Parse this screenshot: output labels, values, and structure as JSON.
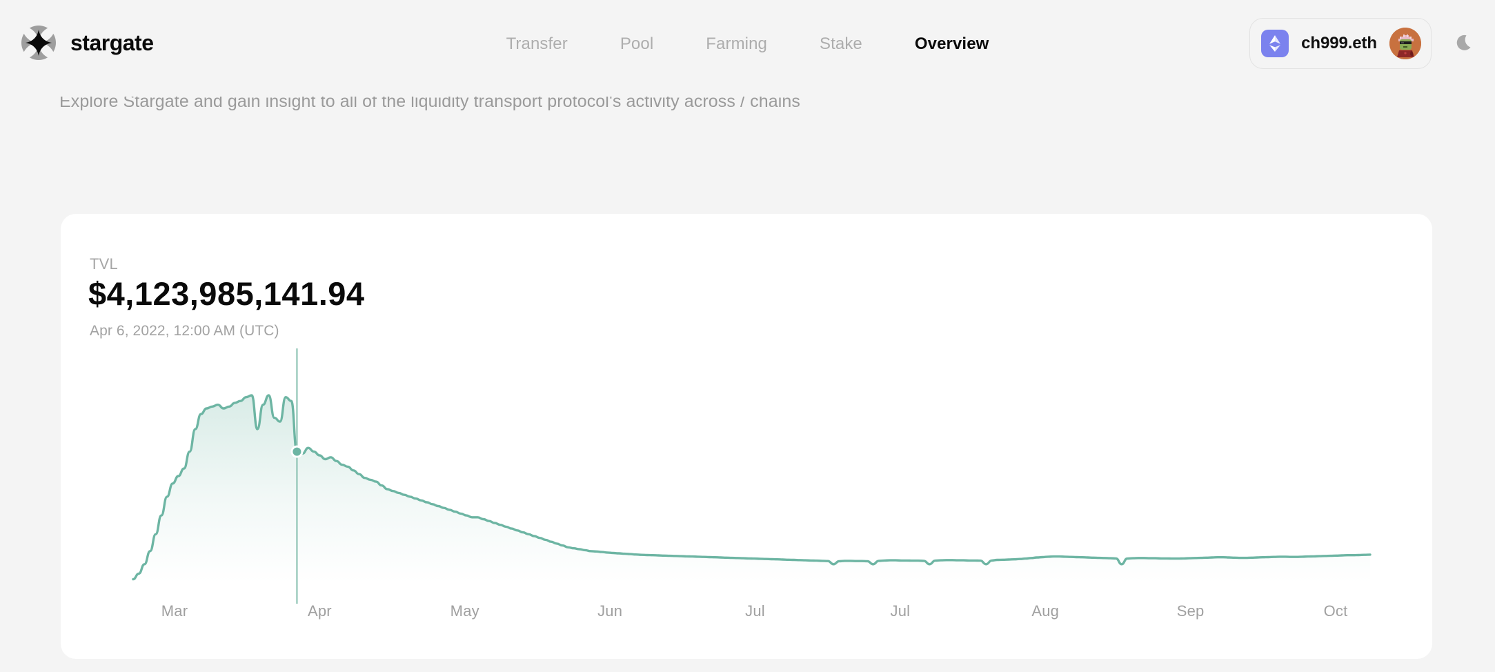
{
  "brand": {
    "name": "stargate",
    "logo_icon": "stargate-star-logo"
  },
  "nav": {
    "items": [
      {
        "label": "Transfer",
        "active": false
      },
      {
        "label": "Pool",
        "active": false
      },
      {
        "label": "Farming",
        "active": false
      },
      {
        "label": "Stake",
        "active": false
      },
      {
        "label": "Overview",
        "active": true
      }
    ]
  },
  "wallet": {
    "chain_icon": "ethereum-diamond-icon",
    "address": "ch999.eth",
    "avatar_icon": "user-avatar"
  },
  "theme_toggle": {
    "icon": "moon-icon"
  },
  "subtitle": "Explore Stargate and gain insight to all of the liquidity transport protocol's activity across / chains",
  "card": {
    "label": "TVL",
    "value": "$4,123,985,141.94",
    "timestamp": "Apr 6, 2022, 12:00 AM (UTC)"
  },
  "colors": {
    "line": "#6db5a3",
    "area_top": "#d8ebe5",
    "page_bg": "#f4f4f4",
    "card_bg": "#ffffff",
    "accent_chain": "#7b82ee",
    "avatar_bg": "#c8713f",
    "text_primary": "#0a0a0a",
    "text_muted": "#a0a0a0"
  },
  "chart_data": {
    "type": "area",
    "title": "TVL",
    "xlabel": "",
    "ylabel": "",
    "grid": false,
    "legend": false,
    "x_tick_labels": [
      "Mar",
      "Apr",
      "May",
      "Jun",
      "Jul",
      "Jul",
      "Aug",
      "Sep",
      "Oct"
    ],
    "x_tick_positions_pct": [
      5.0,
      12.6,
      20.2,
      27.8,
      35.4,
      43.0,
      50.6,
      58.2,
      65.8
    ],
    "highlight": {
      "label": "Apr 6, 2022, 12:00 AM (UTC)",
      "value": 4123985141.94,
      "value_formatted": "$4,123,985,141.94",
      "x_pct": 9.1
    },
    "series": [
      {
        "name": "TVL",
        "units": "USD",
        "values": [
          0.02,
          0.05,
          0.1,
          0.17,
          0.26,
          0.36,
          0.46,
          0.53,
          0.57,
          0.61,
          0.7,
          0.82,
          0.9,
          0.93,
          0.94,
          0.95,
          0.93,
          0.94,
          0.96,
          0.97,
          0.99,
          1.0,
          0.82,
          0.95,
          1.0,
          0.88,
          0.86,
          0.99,
          0.97,
          0.7,
          0.69,
          0.72,
          0.7,
          0.68,
          0.66,
          0.67,
          0.65,
          0.63,
          0.62,
          0.6,
          0.58,
          0.56,
          0.55,
          0.54,
          0.52,
          0.5,
          0.49,
          0.48,
          0.47,
          0.46,
          0.45,
          0.44,
          0.43,
          0.42,
          0.41,
          0.4,
          0.39,
          0.38,
          0.37,
          0.36,
          0.35,
          0.35,
          0.34,
          0.33,
          0.32,
          0.31,
          0.3,
          0.29,
          0.28,
          0.27,
          0.26,
          0.25,
          0.24,
          0.23,
          0.22,
          0.21,
          0.2,
          0.19,
          0.185,
          0.18,
          0.175,
          0.17,
          0.168,
          0.165,
          0.162,
          0.16,
          0.158,
          0.156,
          0.154,
          0.152,
          0.15,
          0.149,
          0.148,
          0.147,
          0.146,
          0.145,
          0.144,
          0.143,
          0.142,
          0.141,
          0.14,
          0.139,
          0.138,
          0.137,
          0.136,
          0.135,
          0.134,
          0.133,
          0.132,
          0.131,
          0.13,
          0.129,
          0.128,
          0.127,
          0.126,
          0.125,
          0.124,
          0.123,
          0.122,
          0.121,
          0.12,
          0.119,
          0.118,
          0.117,
          0.1,
          0.116,
          0.118,
          0.118,
          0.117,
          0.117,
          0.116,
          0.1,
          0.118,
          0.12,
          0.121,
          0.121,
          0.12,
          0.12,
          0.119,
          0.119,
          0.118,
          0.1,
          0.119,
          0.121,
          0.122,
          0.122,
          0.121,
          0.121,
          0.12,
          0.12,
          0.119,
          0.1,
          0.12,
          0.123,
          0.124,
          0.125,
          0.126,
          0.128,
          0.13,
          0.133,
          0.136,
          0.138,
          0.14,
          0.141,
          0.141,
          0.14,
          0.139,
          0.138,
          0.137,
          0.136,
          0.135,
          0.134,
          0.133,
          0.132,
          0.131,
          0.1,
          0.13,
          0.132,
          0.133,
          0.133,
          0.132,
          0.132,
          0.131,
          0.131,
          0.13,
          0.13,
          0.131,
          0.132,
          0.133,
          0.134,
          0.135,
          0.136,
          0.137,
          0.137,
          0.136,
          0.135,
          0.134,
          0.134,
          0.135,
          0.136,
          0.137,
          0.138,
          0.139,
          0.14,
          0.14,
          0.139,
          0.139,
          0.14,
          0.141,
          0.142,
          0.143,
          0.144,
          0.145,
          0.146,
          0.147,
          0.148,
          0.148,
          0.149,
          0.15,
          0.151
        ]
      }
    ]
  }
}
